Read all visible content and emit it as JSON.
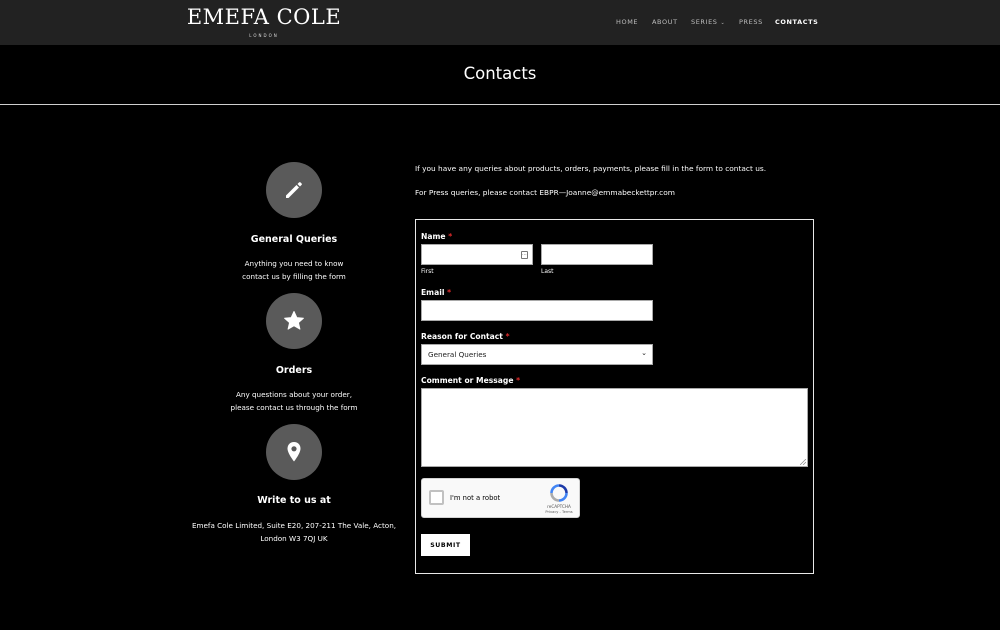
{
  "brand": {
    "name": "EMEFA COLE",
    "tagline": "LONDON"
  },
  "nav": [
    {
      "label": "HOME",
      "active": false
    },
    {
      "label": "ABOUT",
      "active": false
    },
    {
      "label": "SERIES",
      "active": false,
      "dropdown": "⌄"
    },
    {
      "label": "PRESS",
      "active": false
    },
    {
      "label": "CONTACTS",
      "active": true
    }
  ],
  "page": {
    "title": "Contacts"
  },
  "cards": [
    {
      "icon": "pencil-icon",
      "title": "General Queries",
      "lines": [
        "Anything you need to know",
        "contact us by filling the form"
      ]
    },
    {
      "icon": "star-icon",
      "title": "Orders",
      "lines": [
        "Any questions about your order,",
        "please contact us through the form"
      ]
    },
    {
      "icon": "map-pin-icon",
      "title": "Write to us at",
      "lines": [
        "Emefa Cole Limited, Suite E20, 207-211 The Vale, Acton,",
        "London W3 7QJ UK"
      ]
    }
  ],
  "intro": {
    "line1": "If you have any queries about products, orders, payments, please fill in the form to contact us.",
    "line2": "For Press queries, please contact EBPR—Joanne@emmabeckettpr.com"
  },
  "form": {
    "name_label": "Name",
    "first_sub": "First",
    "last_sub": "Last",
    "first_value": "",
    "last_value": "",
    "email_label": "Email",
    "email_value": "",
    "reason_label": "Reason for Contact",
    "reason_selected": "General Queries",
    "comment_label": "Comment or Message",
    "comment_value": "",
    "required_mark": "*",
    "captcha_label": "I'm not a robot",
    "captcha_brand": "reCAPTCHA",
    "captcha_links": "Privacy - Terms",
    "submit_label": "SUBMIT"
  },
  "colors": {
    "header_bg": "#222222",
    "page_bg": "#000000",
    "icon_circle": "#5a5a5a",
    "required": "#e02b2b"
  }
}
